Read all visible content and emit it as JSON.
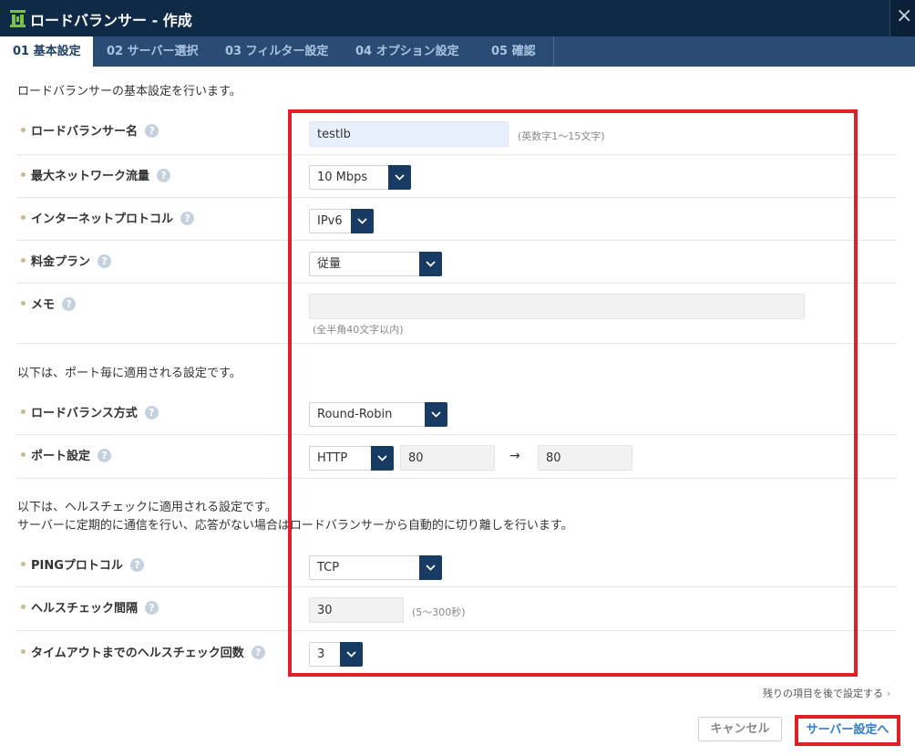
{
  "window": {
    "title": "ロードバランサー - 作成",
    "close_symbol": "×",
    "logo_icon": "load-balancer-logo",
    "colors": {
      "titlebar": "#0e2a47",
      "tab_bar": "#2a4b73",
      "select_button": "#173b63",
      "highlight_red": "#e01f26",
      "link_blue": "#2f7ccc"
    }
  },
  "tabs": [
    {
      "label": "01 基本設定",
      "active": true
    },
    {
      "label": "02 サーバー選択",
      "active": false
    },
    {
      "label": "03 フィルター設定",
      "active": false
    },
    {
      "label": "04 オプション設定",
      "active": false
    },
    {
      "label": "05 確認",
      "active": false
    }
  ],
  "intro": {
    "basic": "ロードバランサーの基本設定を行います。",
    "port": "以下は、ポート毎に適用される設定です。",
    "health_1": "以下は、ヘルスチェックに適用される設定です。",
    "health_2": "サーバーに定期的に通信を行い、応答がない場合はロードバランサーから自動的に切り離しを行います。"
  },
  "help_symbol": "?",
  "form": {
    "name": {
      "label": "ロードバランサー名",
      "value": "testlb",
      "hint": "(英数字1～15文字)"
    },
    "bandwidth": {
      "label": "最大ネットワーク流量",
      "value": "10 Mbps"
    },
    "protocol": {
      "label": "インターネットプロトコル",
      "value": "IPv6"
    },
    "plan": {
      "label": "料金プラン",
      "value": "従量"
    },
    "memo": {
      "label": "メモ",
      "value": "",
      "hint": "(全半角40文字以内)"
    },
    "method": {
      "label": "ロードバランス方式",
      "value": "Round-Robin"
    },
    "port": {
      "label": "ポート設定",
      "protocol": "HTTP",
      "from": "80",
      "arrow": "→",
      "to": "80"
    },
    "ping": {
      "label": "PINGプロトコル",
      "value": "TCP"
    },
    "interval": {
      "label": "ヘルスチェック間隔",
      "value": "30",
      "hint": "(5～300秒)"
    },
    "timeout": {
      "label": "タイムアウトまでのヘルスチェック回数",
      "value": "3"
    }
  },
  "footer": {
    "later_link": "残りの項目を後で設定する",
    "later_chevron": "›",
    "cancel": "キャンセル",
    "next": "サーバー設定へ"
  }
}
